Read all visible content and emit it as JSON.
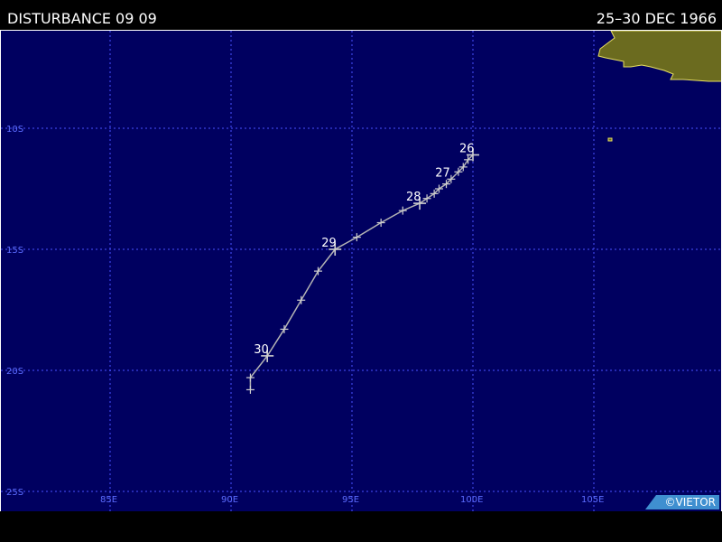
{
  "header": {
    "title": "DISTURBANCE 09 09",
    "date_range": "25–30 DEC 1966"
  },
  "map": {
    "lon_labels": [
      "85E",
      "90E",
      "95E",
      "100E",
      "105E"
    ],
    "lat_labels": [
      "10S",
      "15S",
      "20S",
      "25S"
    ],
    "colors": {
      "ocean": "#000060",
      "grid": "#4a52ff",
      "land_fill": "#6b6b1f",
      "land_outline": "#e8e060",
      "track": "#b4b4b4",
      "day_label": "#ffffff"
    },
    "track": {
      "points": [
        {
          "lon": 100.0,
          "lat": -11.1
        },
        {
          "lon": 99.8,
          "lat": -11.3
        },
        {
          "lon": 99.6,
          "lat": -11.6
        },
        {
          "lon": 99.4,
          "lat": -11.8
        },
        {
          "lon": 99.1,
          "lat": -12.1
        },
        {
          "lon": 98.9,
          "lat": -12.3
        },
        {
          "lon": 98.6,
          "lat": -12.5
        },
        {
          "lon": 98.4,
          "lat": -12.7
        },
        {
          "lon": 98.1,
          "lat": -12.9
        },
        {
          "lon": 97.8,
          "lat": -13.1
        },
        {
          "lon": 97.1,
          "lat": -13.4
        },
        {
          "lon": 96.2,
          "lat": -13.9
        },
        {
          "lon": 95.2,
          "lat": -14.5
        },
        {
          "lon": 94.3,
          "lat": -15.0
        },
        {
          "lon": 93.6,
          "lat": -15.9
        },
        {
          "lon": 92.9,
          "lat": -17.1
        },
        {
          "lon": 92.2,
          "lat": -18.3
        },
        {
          "lon": 91.5,
          "lat": -19.4
        },
        {
          "lon": 90.8,
          "lat": -20.3
        },
        {
          "lon": 90.8,
          "lat": -20.8
        }
      ],
      "day_labels": [
        {
          "label": "26",
          "lon": 100.0,
          "lat": -11.1
        },
        {
          "label": "27",
          "lon": 99.0,
          "lat": -12.1
        },
        {
          "label": "28",
          "lon": 97.8,
          "lat": -13.1
        },
        {
          "label": "29",
          "lon": 94.3,
          "lat": -15.0
        },
        {
          "label": "30",
          "lon": 91.5,
          "lat": -19.4
        }
      ]
    },
    "land_name": "sumatra-java-coast"
  },
  "credit": "©VIETOR"
}
